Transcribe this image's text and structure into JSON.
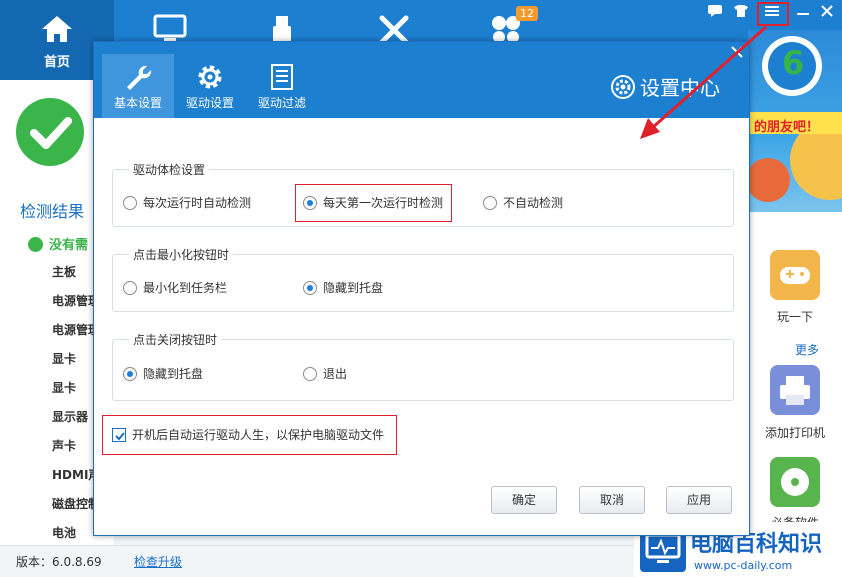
{
  "app": {
    "home_tab": "首页",
    "badge_count": "12",
    "result_title": "检测结果",
    "no_need": "没有需",
    "hardware_items": [
      "主板",
      "电源管理",
      "电源管理",
      "显卡",
      "显卡",
      "显示器",
      "声卡",
      "HDMI声",
      "磁盘控制",
      "电池"
    ],
    "side_items": {
      "play": "玩一下",
      "more": "更多",
      "printer": "添加打印机",
      "software": "必备软件"
    },
    "banner_text": "的朋友吧！",
    "version": "版本：6.0.8.69",
    "upgrade": "检查升级",
    "banner_number": "6"
  },
  "dialog": {
    "title": "设置中心",
    "tabs": [
      {
        "label": "基本设置",
        "icon": "wrench-icon",
        "active": true
      },
      {
        "label": "驱动设置",
        "icon": "gear-icon",
        "active": false
      },
      {
        "label": "驱动过滤",
        "icon": "list-icon",
        "active": false
      }
    ],
    "group_check": {
      "title": "驱动体检设置",
      "options": [
        "每次运行时自动检测",
        "每天第一次运行时检测",
        "不自动检测"
      ],
      "selected": 1
    },
    "group_minimize": {
      "title": "点击最小化按钮时",
      "options": [
        "最小化到任务栏",
        "隐藏到托盘"
      ],
      "selected": 1
    },
    "group_close": {
      "title": "点击关闭按钮时",
      "options": [
        "隐藏到托盘",
        "退出"
      ],
      "selected": 0
    },
    "autostart": {
      "label": "开机后自动运行驱动人生，以保护电脑驱动文件",
      "checked": true
    },
    "buttons": {
      "ok": "确定",
      "cancel": "取消",
      "apply": "应用"
    }
  },
  "watermark": {
    "title": "电脑百科知识",
    "url": "www.pc-daily.com"
  },
  "colors": {
    "primary": "#1d7fd0",
    "active_tab": "#3f96dc",
    "highlight": "#e0202a",
    "success": "#3bb44a"
  }
}
